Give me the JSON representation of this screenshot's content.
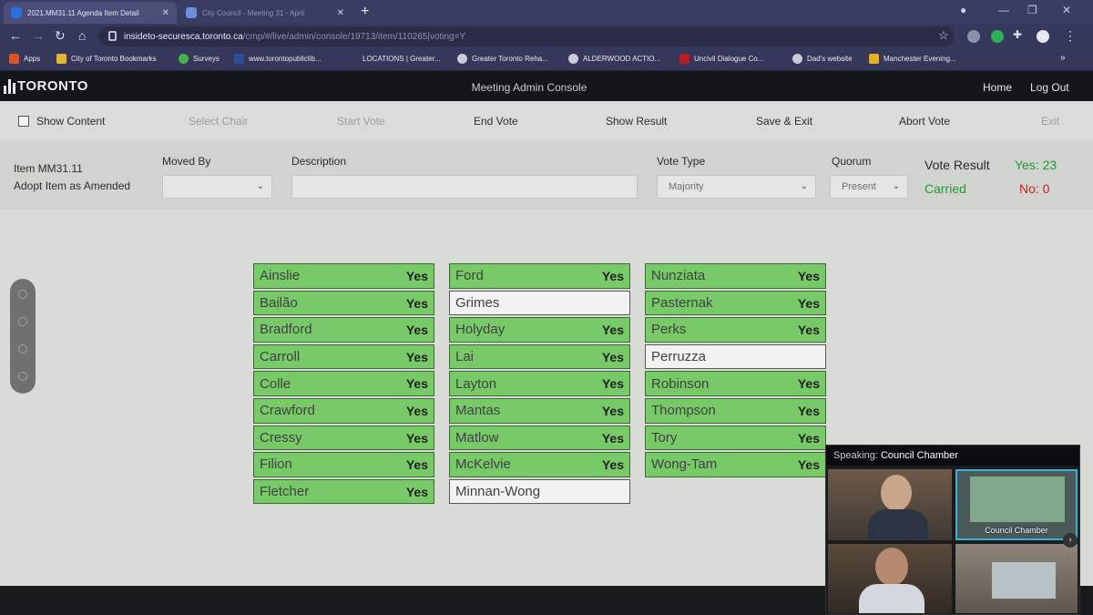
{
  "browser": {
    "tabs": [
      {
        "title": "2021.MM31.11 Agenda Item Detail",
        "close": "✕"
      },
      {
        "title": "City Council - Meeting 31 - April",
        "close": "✕"
      }
    ],
    "url_host": "insideto-securesca.toronto.ca",
    "url_path": "/cmp/#/live/admin/console/19713/item/110265|voting=Y",
    "bookmarks": [
      "Apps",
      "City of Toronto Bookmarks",
      "Surveys",
      "www.torontopubliclib...",
      "LOCATIONS | Greater...",
      "Greater Toronto Reha...",
      "ALDERWOOD ACTIO...",
      "Uncivil Dialogue Co...",
      "Dad's website",
      "Manchester Evening..."
    ],
    "more_bookmarks": "»"
  },
  "app": {
    "logo": "TORONTO",
    "title": "Meeting Admin Console",
    "home": "Home",
    "logout": "Log Out"
  },
  "toolbar": {
    "show_content": "Show Content",
    "select_chair": "Select Chair",
    "start_vote": "Start Vote",
    "end_vote": "End Vote",
    "show_result": "Show Result",
    "save_exit": "Save & Exit",
    "abort_vote": "Abort Vote",
    "exit": "Exit"
  },
  "item": {
    "id": "Item MM31.11",
    "action": "Adopt Item as Amended",
    "moved_by_label": "Moved By",
    "moved_by_value": "",
    "description_label": "Description",
    "description_value": "",
    "vote_type_label": "Vote Type",
    "vote_type_value": "Majority",
    "quorum_label": "Quorum",
    "quorum_value": "Present",
    "result_label": "Vote Result",
    "result_status": "Carried",
    "yes_text": "Yes: 23",
    "no_text": "No: 0"
  },
  "colors": {
    "yes_green": "#78c967",
    "carried_green": "#1f9a36",
    "no_red": "#d0202a"
  },
  "members": {
    "col1": [
      {
        "name": "Ainslie",
        "vote": "Yes"
      },
      {
        "name": "Bailão",
        "vote": "Yes"
      },
      {
        "name": "Bradford",
        "vote": "Yes"
      },
      {
        "name": "Carroll",
        "vote": "Yes"
      },
      {
        "name": "Colle",
        "vote": "Yes"
      },
      {
        "name": "Crawford",
        "vote": "Yes"
      },
      {
        "name": "Cressy",
        "vote": "Yes"
      },
      {
        "name": "Filion",
        "vote": "Yes"
      },
      {
        "name": "Fletcher",
        "vote": "Yes"
      }
    ],
    "col2": [
      {
        "name": "Ford",
        "vote": "Yes"
      },
      {
        "name": "Grimes",
        "vote": ""
      },
      {
        "name": "Holyday",
        "vote": "Yes"
      },
      {
        "name": "Lai",
        "vote": "Yes"
      },
      {
        "name": "Layton",
        "vote": "Yes"
      },
      {
        "name": "Mantas",
        "vote": "Yes"
      },
      {
        "name": "Matlow",
        "vote": "Yes"
      },
      {
        "name": "McKelvie",
        "vote": "Yes"
      },
      {
        "name": "Minnan-Wong",
        "vote": ""
      }
    ],
    "col3": [
      {
        "name": "Nunziata",
        "vote": "Yes"
      },
      {
        "name": "Pasternak",
        "vote": "Yes"
      },
      {
        "name": "Perks",
        "vote": "Yes"
      },
      {
        "name": "Perruzza",
        "vote": ""
      },
      {
        "name": "Robinson",
        "vote": "Yes"
      },
      {
        "name": "Thompson",
        "vote": "Yes"
      },
      {
        "name": "Tory",
        "vote": "Yes"
      },
      {
        "name": "Wong-Tam",
        "vote": "Yes"
      }
    ]
  },
  "video": {
    "speaking_label": "Speaking:",
    "speaking_name": "Council Chamber",
    "tile_label": "Council Chamber"
  }
}
